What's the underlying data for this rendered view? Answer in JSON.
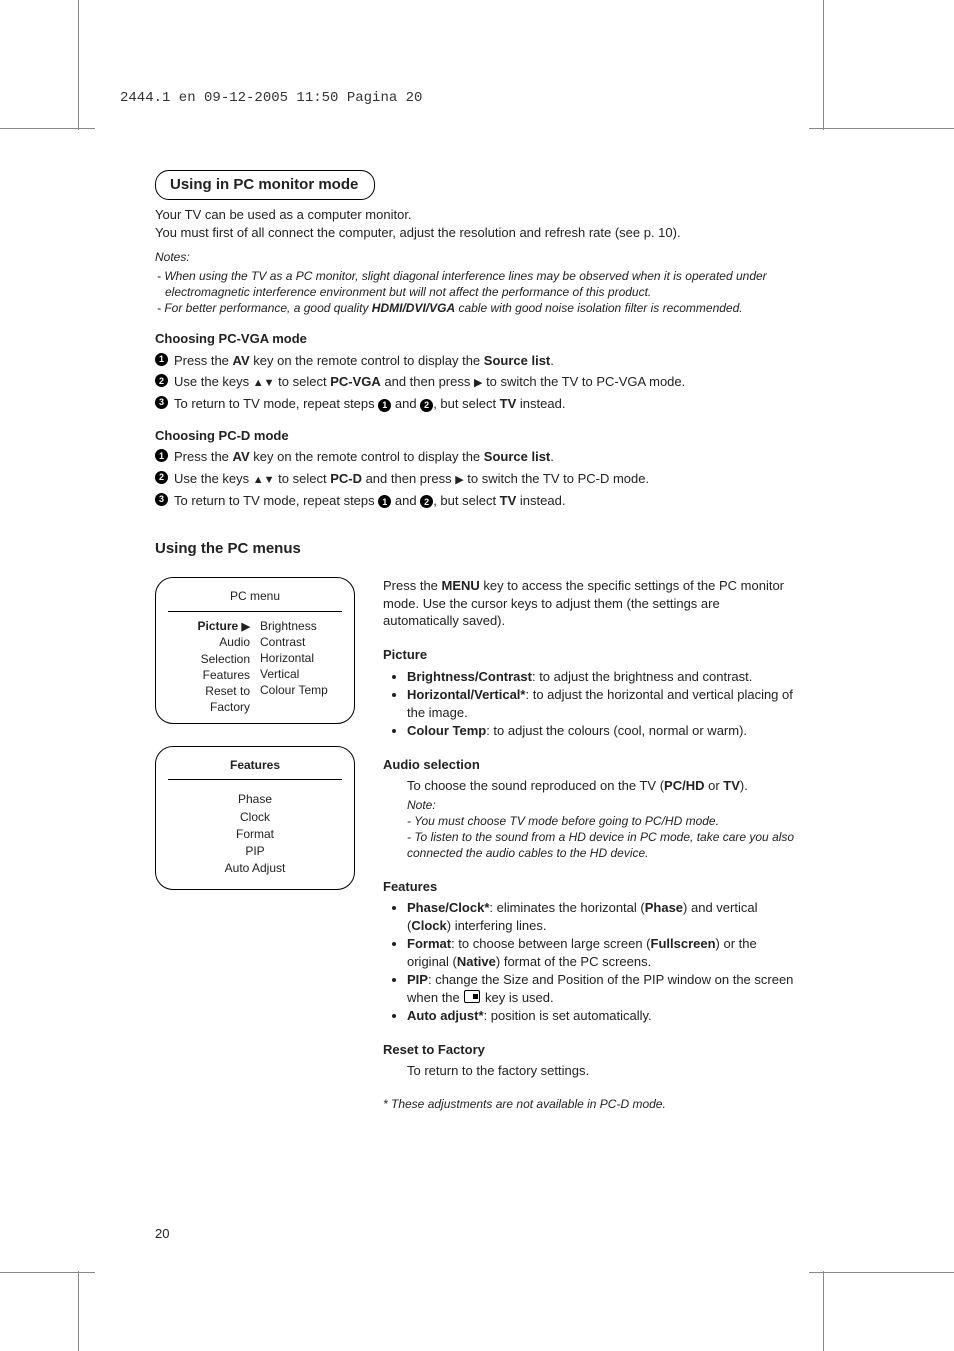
{
  "print_header": "2444.1 en  09-12-2005  11:50  Pagina 20",
  "page_number": "20",
  "title1": "Using in PC monitor mode",
  "intro_line1": "Your TV can be used as a computer monitor.",
  "intro_line2": "You must first of all connect the computer, adjust the resolution and refresh rate (see p. 10).",
  "notes_label": "Notes:",
  "note1": "- When using the TV as a PC monitor, slight diagonal interference lines may be observed when it is operated under electromagnetic interference environment but will not affect the performance of this product.",
  "note2_a": "- For better performance, a good quality ",
  "note2_b": "HDMI/DVI/VGA",
  "note2_c": " cable with good noise isolation filter is recommended.",
  "sub_vga": "Choosing PC-VGA mode",
  "vga_step1_a": "Press the ",
  "vga_step1_b": "AV",
  "vga_step1_c": " key on the remote control to display the ",
  "vga_step1_d": "Source list",
  "vga_step1_e": ".",
  "vga_step2_a": "Use the keys ",
  "vga_step2_b": " to select ",
  "vga_step2_c": "PC-VGA",
  "vga_step2_d": " and then press ",
  "vga_step2_e": " to switch the TV to PC-VGA mode.",
  "vga_step3_a": "To return to TV mode, repeat steps ",
  "vga_step3_b": " and ",
  "vga_step3_c": ", but select ",
  "vga_step3_d": "TV",
  "vga_step3_e": " instead.",
  "sub_pcd": "Choosing PC-D mode",
  "pcd_step2_c": "PC-D",
  "pcd_step2_e": " to switch the TV to PC-D mode.",
  "title2": "Using the PC menus",
  "menu1_title": "PC menu",
  "menu1_left": [
    "Picture",
    "Audio Selection",
    "Features",
    "Reset to Factory"
  ],
  "menu1_right": [
    "Brightness",
    "Contrast",
    "Horizontal",
    "Vertical",
    "Colour Temp"
  ],
  "menu2_title": "Features",
  "menu2_items": [
    "Phase",
    "Clock",
    "Format",
    "PIP",
    "Auto Adjust"
  ],
  "right_intro_a": "Press the ",
  "right_intro_b": "MENU",
  "right_intro_c": " key to access the specific settings of the PC monitor mode. Use the cursor keys to adjust them (the settings are automatically saved).",
  "picture_head": "Picture",
  "picture_b1_a": "Brightness/Contrast",
  "picture_b1_b": ": to adjust the brightness and contrast.",
  "picture_b2_a": "Horizontal/Vertical*",
  "picture_b2_b": ": to adjust the horizontal and vertical placing of the image.",
  "picture_b3_a": "Colour Temp",
  "picture_b3_b": ": to adjust the colours (cool, normal or warm).",
  "audio_head": "Audio selection",
  "audio_body_a": "To choose the sound reproduced on the TV (",
  "audio_body_b": "PC/HD",
  "audio_body_c": " or ",
  "audio_body_d": "TV",
  "audio_body_e": ").",
  "audio_note_label": "Note:",
  "audio_note1": "- You must choose TV mode before going to PC/HD mode.",
  "audio_note2": "- To listen to the sound from a HD device in PC mode, take care you also connected the audio cables to the HD device.",
  "features_head": "Features",
  "feat_b1_a": "Phase/Clock*",
  "feat_b1_b": ": eliminates the horizontal (",
  "feat_b1_c": "Phase",
  "feat_b1_d": ") and vertical (",
  "feat_b1_e": "Clock",
  "feat_b1_f": ") interfering lines.",
  "feat_b2_a": "Format",
  "feat_b2_b": ": to choose between large screen (",
  "feat_b2_c": "Fullscreen",
  "feat_b2_d": ") or the original (",
  "feat_b2_e": "Native",
  "feat_b2_f": ") format of the PC screens.",
  "feat_b3_a": "PIP",
  "feat_b3_b": ": change the Size and Position of the PIP window on the screen when the ",
  "feat_b3_c": " key is used.",
  "feat_b4_a": "Auto adjust*",
  "feat_b4_b": ": position is set automatically.",
  "reset_head": "Reset to Factory",
  "reset_body": "To return to the factory settings.",
  "footnote": "* These adjustments are not available in PC-D mode."
}
